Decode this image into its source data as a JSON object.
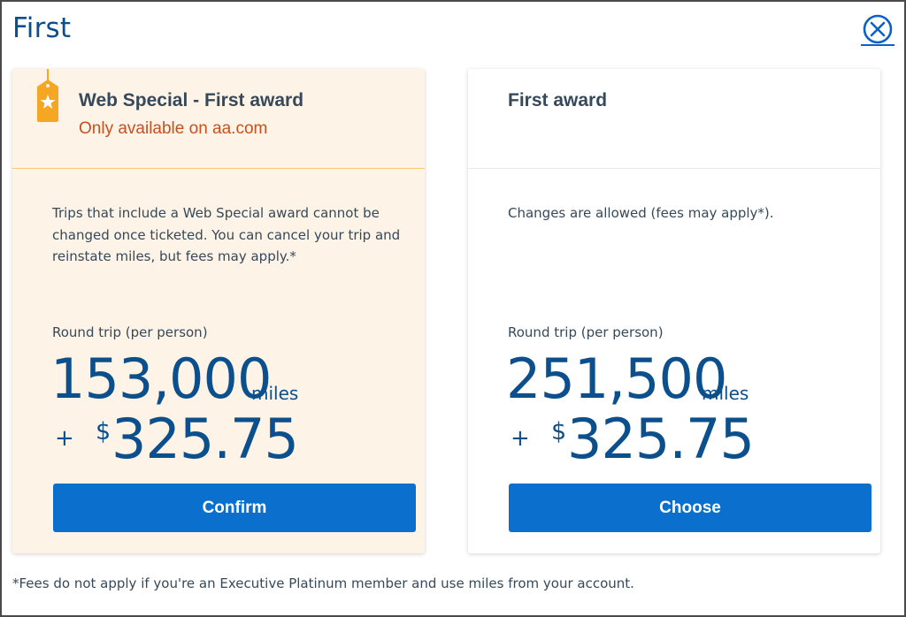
{
  "dialog": {
    "title": "First",
    "close_icon": "close-circle-icon"
  },
  "cards": [
    {
      "title": "Web Special - First award",
      "subtitle": "Only available on aa.com",
      "tag_icon": "star-tag-icon",
      "description": "Trips that include a Web Special award cannot be changed once ticketed. You can cancel your trip and reinstate miles, but fees may apply.*",
      "price_label": "Round trip (per person)",
      "miles": "153,000",
      "miles_unit": "miles",
      "plus": "+",
      "currency": "$",
      "fees": "325.75",
      "button_label": "Confirm"
    },
    {
      "title": "First award",
      "description": "Changes are allowed (fees may apply*).",
      "price_label": "Round trip (per person)",
      "miles": "251,500",
      "miles_unit": "miles",
      "plus": "+",
      "currency": "$",
      "fees": "325.75",
      "button_label": "Choose"
    }
  ],
  "footnote": "*Fees do not apply if you're an Executive Platinum member and use miles from your account.",
  "colors": {
    "accent_blue": "#0b6fcd",
    "heading_blue": "#0b4f8c",
    "web_special_bg": "#fdf3e6",
    "web_special_text": "#c8501e",
    "tag_gold": "#f5a623"
  }
}
